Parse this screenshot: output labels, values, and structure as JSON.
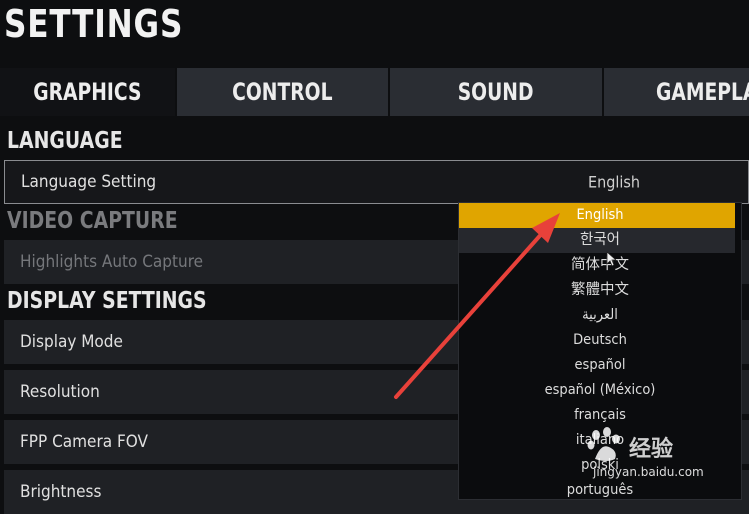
{
  "title": "SETTINGS",
  "tabs": [
    {
      "label": "GRAPHICS",
      "active": true
    },
    {
      "label": "CONTROL",
      "active": false
    },
    {
      "label": "SOUND",
      "active": false
    },
    {
      "label": "GAMEPLAY",
      "active": false
    }
  ],
  "sections": {
    "language": "LANGUAGE",
    "video_capture": "VIDEO CAPTURE",
    "display_settings": "DISPLAY SETTINGS"
  },
  "rows": {
    "language_setting": {
      "label": "Language Setting",
      "value": "English"
    },
    "highlights_auto_capture": {
      "label": "Highlights Auto Capture"
    },
    "display_mode": {
      "label": "Display Mode"
    },
    "resolution": {
      "label": "Resolution"
    },
    "fpp_camera_fov": {
      "label": "FPP Camera FOV"
    },
    "brightness": {
      "label": "Brightness"
    }
  },
  "language_dropdown": {
    "selected": "English",
    "options": [
      "English",
      "한국어",
      "简体中文",
      "繁體中文",
      "العربية",
      "Deutsch",
      "español",
      "español (México)",
      "français",
      "italiano",
      "polski",
      "português"
    ]
  },
  "watermark": {
    "brand": "经验",
    "url": "jingyan.baidu.com"
  },
  "colors": {
    "accent": "#e0a500",
    "arrow": "#e8413a",
    "tab_inactive": "#2a2d33"
  }
}
